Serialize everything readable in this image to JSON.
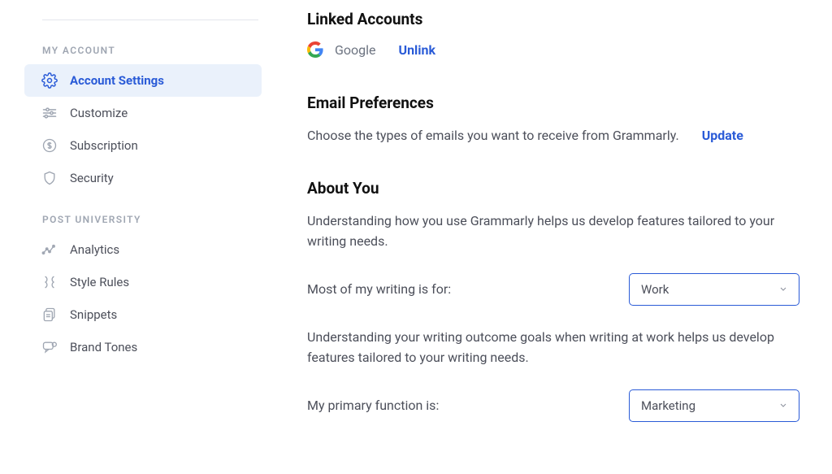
{
  "sidebar": {
    "section1_title": "MY ACCOUNT",
    "items1": [
      {
        "label": "Account Settings"
      },
      {
        "label": "Customize"
      },
      {
        "label": "Subscription"
      },
      {
        "label": "Security"
      }
    ],
    "section2_title": "POST UNIVERSITY",
    "items2": [
      {
        "label": "Analytics"
      },
      {
        "label": "Style Rules"
      },
      {
        "label": "Snippets"
      },
      {
        "label": "Brand Tones"
      }
    ]
  },
  "linked": {
    "heading": "Linked Accounts",
    "provider": "Google",
    "action": "Unlink"
  },
  "email": {
    "heading": "Email Preferences",
    "desc": "Choose the types of emails you want to receive from Grammarly.",
    "action": "Update"
  },
  "about": {
    "heading": "About You",
    "desc1": "Understanding how you use Grammarly helps us develop features tailored to your writing needs.",
    "q1": "Most of my writing is for:",
    "a1": "Work",
    "desc2": "Understanding your writing outcome goals when writing at work helps us develop features tailored to your writing needs.",
    "q2": "My primary function is:",
    "a2": "Marketing"
  }
}
